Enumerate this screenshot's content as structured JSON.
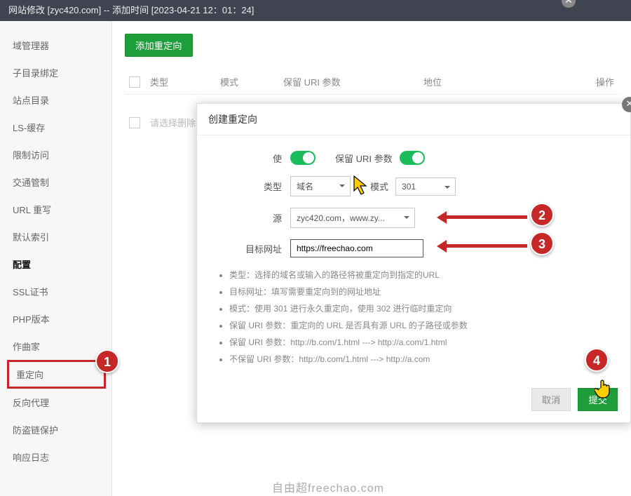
{
  "titlebar": "网站修改 [zyc420.com] -- 添加时间 [2023-04-21 12：01：24]",
  "sidebar": {
    "items": [
      "域管理器",
      "子目录绑定",
      "站点目录",
      "LS-缓存",
      "限制访问",
      "交通管制",
      "URL 重写",
      "默认索引",
      "配置",
      "SSL证书",
      "PHP版本",
      "作曲家",
      "重定向",
      "反向代理",
      "防盗链保护",
      "响应日志"
    ],
    "active_index": 8,
    "boxed_index": 12
  },
  "content": {
    "add_button": "添加重定向",
    "columns": {
      "type": "类型",
      "mode": "模式",
      "keep_uri": "保留 URI 参数",
      "position": "地位",
      "ops": "操作"
    },
    "placeholder_row": "请选择删除"
  },
  "modal": {
    "title": "创建重定向",
    "labels": {
      "enable": "使",
      "keep_uri": "保留 URI 参数",
      "type": "类型",
      "mode": "模式",
      "source": "源",
      "target": "目标网址"
    },
    "type_value": "域名",
    "mode_value": "301",
    "source_value": "zyc420.com，www.zy...",
    "target_value": "https://freechao.com",
    "tips": [
      "类型：选择的域名或输入的路径将被重定向到指定的URL",
      "目标网址：填写需要重定向到的网址地址",
      "模式：使用 301 进行永久重定向，使用 302 进行临时重定向",
      "保留 URI 参数：重定向的 URL 是否具有源 URL 的子路径或参数",
      "保留 URI 参数：http://b.com/1.html ---> http://a.com/1.html",
      "不保留 URI 参数：http://b.com/1.html ---> http://a.com"
    ],
    "cancel": "取消",
    "submit": "提交"
  },
  "badges": {
    "b1": "1",
    "b2": "2",
    "b3": "3",
    "b4": "4"
  },
  "watermark": "自由超freechao.com"
}
